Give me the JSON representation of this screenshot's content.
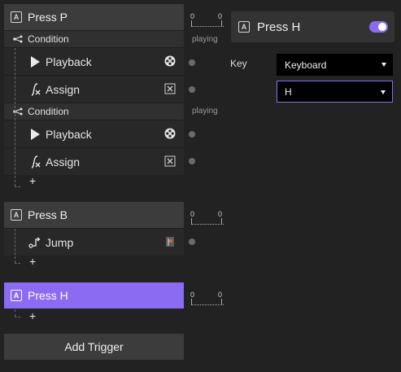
{
  "triggers": [
    {
      "name": "Press P",
      "conditions": [
        {
          "label": "Condition",
          "actions": [
            {
              "label": "Playback",
              "icon": "playback-icon",
              "right": "reel-icon"
            },
            {
              "label": "Assign",
              "icon": "function-icon",
              "right": "x-box-icon"
            }
          ]
        },
        {
          "label": "Condition",
          "actions": [
            {
              "label": "Playback",
              "icon": "playback-icon",
              "right": "reel-icon"
            },
            {
              "label": "Assign",
              "icon": "function-icon",
              "right": "x-box-icon"
            }
          ]
        }
      ],
      "add": "+"
    },
    {
      "name": "Press B",
      "actions": [
        {
          "label": "Jump",
          "icon": "jump-icon",
          "right": "flag-icon"
        }
      ],
      "add": "+"
    },
    {
      "name": "Press H",
      "add": "+"
    }
  ],
  "add_trigger_label": "Add Trigger",
  "timeline": {
    "zero": "0",
    "playing": "playing"
  },
  "badge": "A",
  "inspector": {
    "title": "Press H",
    "key_label": "Key",
    "source_value": "Keyboard",
    "key_value": "H",
    "enabled": true
  },
  "colors": {
    "accent": "#8a6cf2",
    "background": "#222222",
    "row": "#3c3c3c"
  }
}
